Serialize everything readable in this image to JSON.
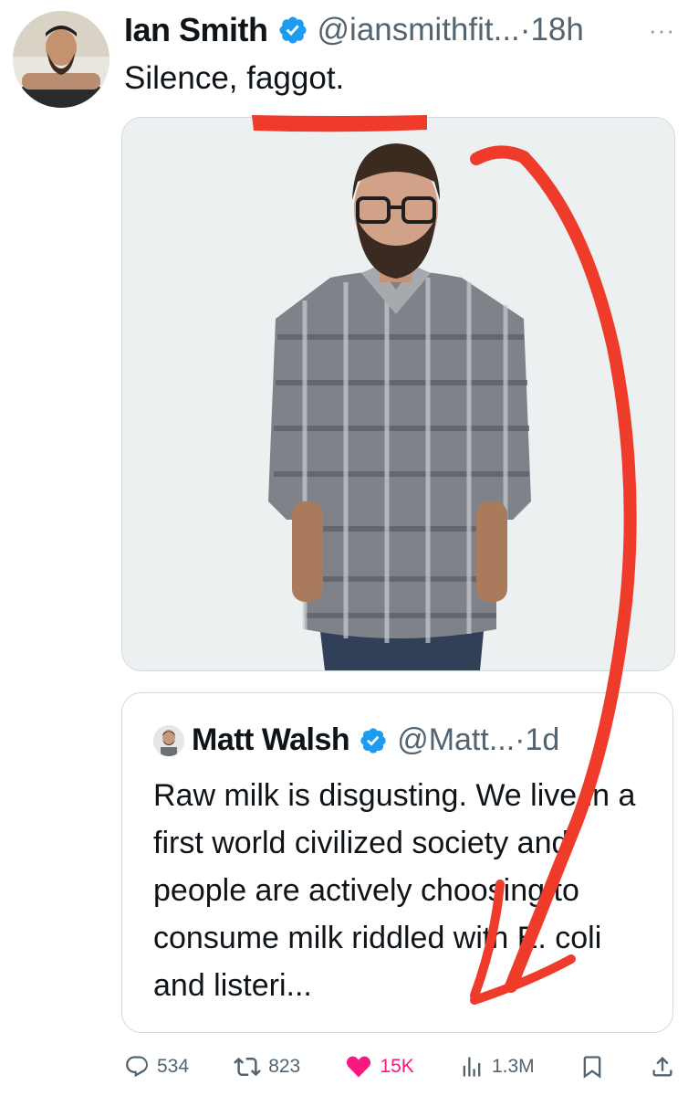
{
  "tweet": {
    "author_name": "Ian Smith",
    "handle": "@iansmithfit...",
    "separator": "·",
    "time": "18h",
    "more_label": "···",
    "text": "Silence, faggot."
  },
  "quoted_tweet": {
    "author_name": "Matt Walsh",
    "handle": "@Matt...",
    "separator": "·",
    "time": "1d",
    "text": "Raw milk is disgusting. We live in a first world civilized society and people are actively choosing to consume milk riddled with E. coli and listeri..."
  },
  "actions": {
    "replies": "534",
    "reposts": "823",
    "likes": "15K",
    "views": "1.3M"
  },
  "colors": {
    "verified": "#1d9bf0",
    "like": "#f91880",
    "annotation": "#ee3b2a"
  },
  "icons": [
    "verified-badge-icon",
    "more-icon",
    "reply-icon",
    "repost-icon",
    "like-icon",
    "views-icon",
    "bookmark-icon",
    "share-icon"
  ]
}
